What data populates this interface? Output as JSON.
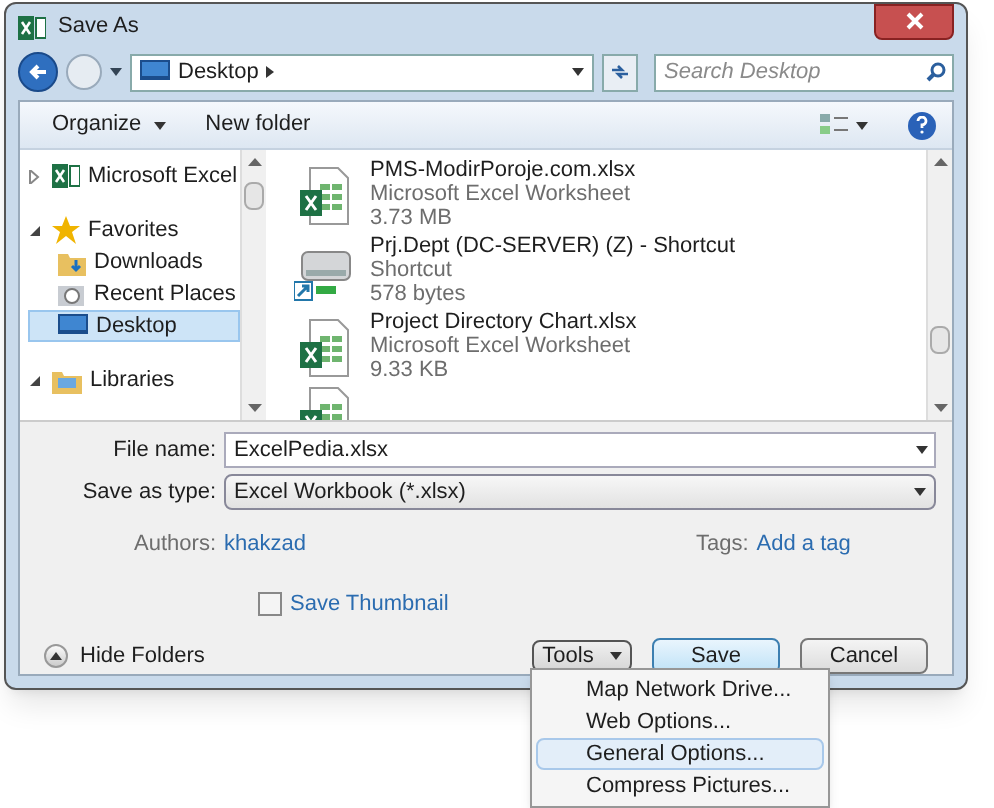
{
  "window": {
    "title": "Save As"
  },
  "address": {
    "location": "Desktop"
  },
  "search": {
    "placeholder": "Search Desktop"
  },
  "toolbar": [
    {
      "label": "Organize",
      "has_menu": true
    },
    {
      "label": "New folder",
      "has_menu": false
    }
  ],
  "nav": [
    {
      "label": "Microsoft Excel",
      "kind": "excel",
      "expanded": false
    },
    {
      "label": "Favorites",
      "kind": "star",
      "expanded": true,
      "children": [
        {
          "label": "Downloads",
          "kind": "downloads",
          "selected": false
        },
        {
          "label": "Recent Places",
          "kind": "recent",
          "selected": false
        },
        {
          "label": "Desktop",
          "kind": "desktop",
          "selected": true
        }
      ]
    },
    {
      "label": "Libraries",
      "kind": "libraries",
      "expanded": true
    }
  ],
  "files": [
    {
      "name": "PMS-ModirPoroje.com.xlsx",
      "type": "Microsoft Excel Worksheet",
      "size": "3.73 MB",
      "kind": "excel"
    },
    {
      "name": "Prj.Dept (DC-SERVER) (Z) - Shortcut",
      "type": "Shortcut",
      "size": "578 bytes",
      "kind": "shortcut"
    },
    {
      "name": "Project Directory Chart.xlsx",
      "type": "Microsoft Excel Worksheet",
      "size": "9.33 KB",
      "kind": "excel"
    }
  ],
  "form": {
    "file_name": {
      "label": "File name:",
      "value": "ExcelPedia.xlsx"
    },
    "save_as_type": {
      "label": "Save as type:",
      "value": "Excel Workbook (*.xlsx)"
    },
    "authors": {
      "label": "Authors:",
      "value": "khakzad"
    },
    "tags": {
      "label": "Tags:",
      "value": "Add a tag"
    },
    "thumbnail": {
      "label": "Save Thumbnail",
      "checked": false
    }
  },
  "hide_folders": "Hide Folders",
  "buttons": [
    {
      "label": "Tools",
      "kind": "menu"
    },
    {
      "label": "Save",
      "kind": "default"
    },
    {
      "label": "Cancel",
      "kind": "plain"
    }
  ],
  "tools_menu": [
    {
      "label": "Map Network Drive...",
      "selected": false
    },
    {
      "label": "Web Options...",
      "selected": false
    },
    {
      "label": "General Options...",
      "selected": true
    },
    {
      "label": "Compress Pictures...",
      "selected": false
    }
  ]
}
